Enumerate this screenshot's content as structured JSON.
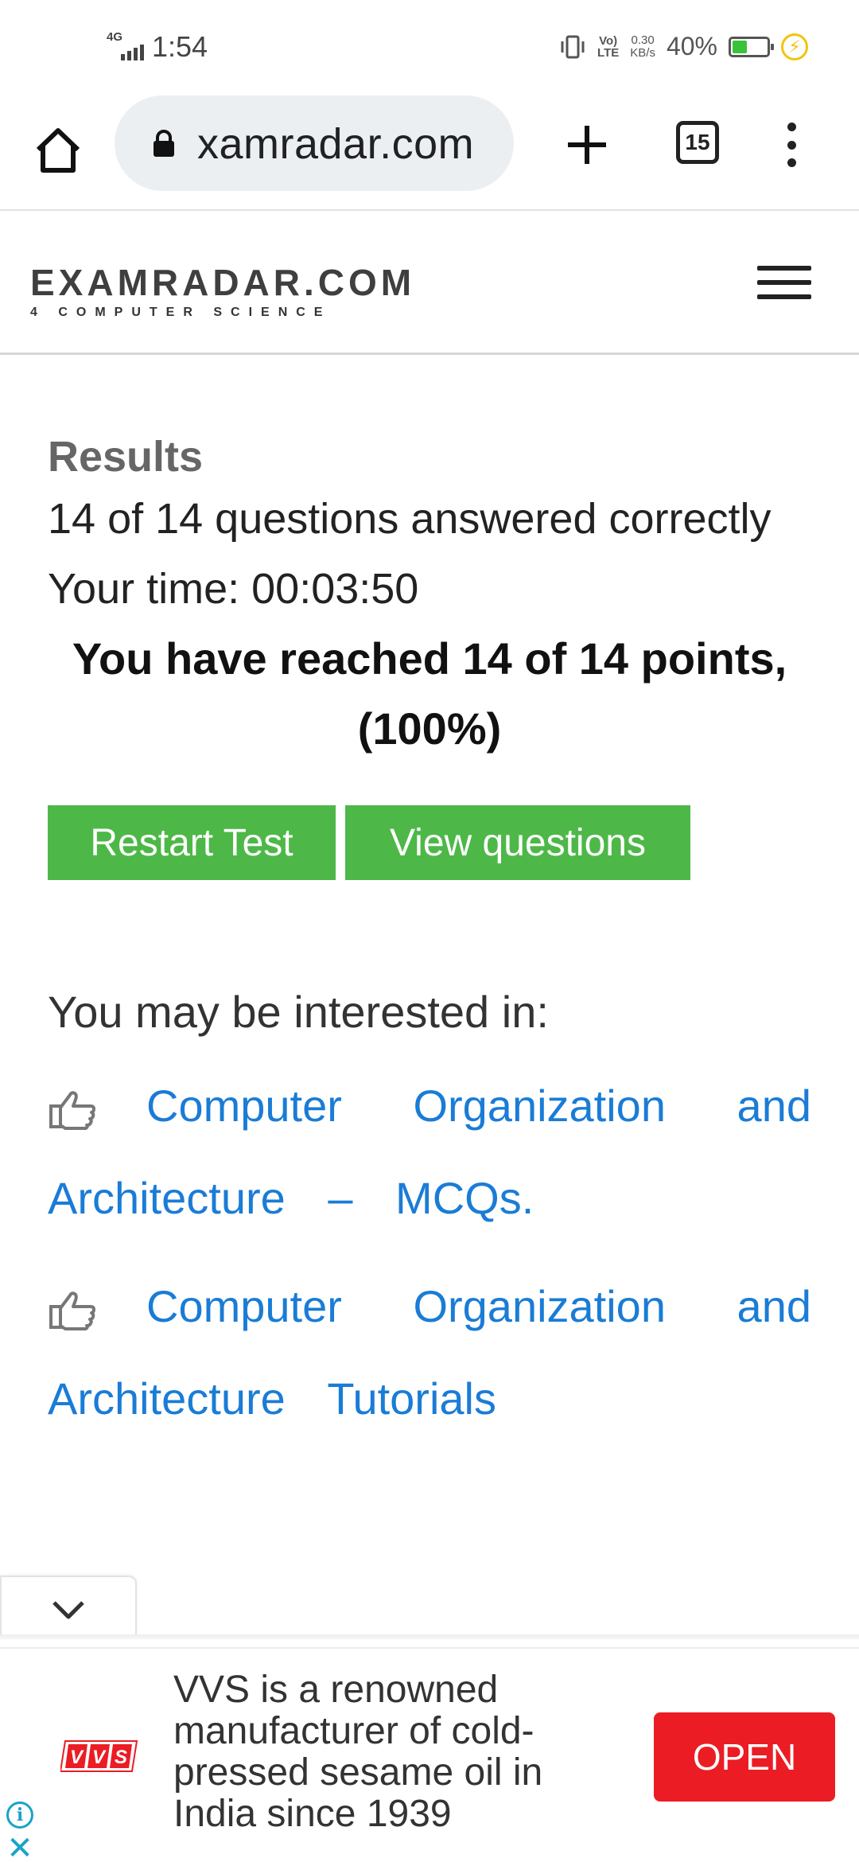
{
  "status_bar": {
    "network_type": "4G",
    "time": "1:54",
    "volte_label_top": "Vo)",
    "volte_label_bottom": "LTE",
    "speed_value": "0.30",
    "speed_unit": "KB/s",
    "battery_percent": "40%",
    "battery_level": 0.4,
    "battery_color": "#3cc13b"
  },
  "browser": {
    "url": "xamradar.com",
    "tab_count": "15"
  },
  "site": {
    "logo_main": "EXAMRADAR.COM",
    "logo_sub": "4 COMPUTER SCIENCE"
  },
  "results": {
    "title": "Results",
    "answered_line": "14 of 14 questions answered correctly",
    "time_line": "Your time: 00:03:50",
    "points_line": "You have reached 14 of 14 points, (100%)"
  },
  "buttons": {
    "restart_label": "Restart Test",
    "view_label": "View questions",
    "color": "#4db848"
  },
  "interested": {
    "heading": "You may be interested in:",
    "links": [
      {
        "label": "Computer Organization and Architecture – MCQs.",
        "icon": "thumbs-up-icon"
      },
      {
        "label": "Computer Organization and Architecture Tutorials",
        "icon": "thumbs-up-icon"
      }
    ],
    "link_color": "#1a7cd6"
  },
  "ad": {
    "brand": "VVS",
    "text": "VVS is a renowned manufacturer of cold-pressed sesame oil in India since 1939",
    "cta_label": "OPEN",
    "cta_color": "#ec1c24"
  }
}
